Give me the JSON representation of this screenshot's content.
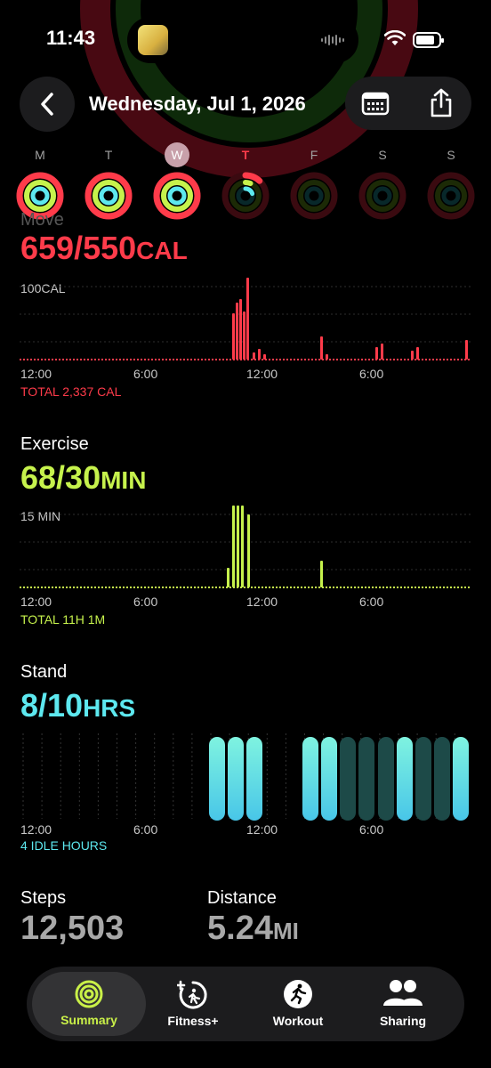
{
  "status": {
    "time": "11:43"
  },
  "header": {
    "date": "Wednesday, Jul 1, 2026"
  },
  "week": [
    {
      "letter": "M",
      "state": "closed"
    },
    {
      "letter": "T",
      "state": "closed"
    },
    {
      "letter": "W",
      "state": "selected"
    },
    {
      "letter": "T",
      "state": "today"
    },
    {
      "letter": "F",
      "state": "empty"
    },
    {
      "letter": "S",
      "state": "empty"
    },
    {
      "letter": "S",
      "state": "empty"
    }
  ],
  "move": {
    "label": "Move",
    "value": "659/550",
    "unit": "CAL",
    "scale_label": "100CAL",
    "x_labels": [
      "12:00",
      "6:00",
      "12:00",
      "6:00"
    ],
    "footer": "TOTAL 2,337 CAL",
    "color": "#ff3b4a"
  },
  "exercise": {
    "label": "Exercise",
    "value": "68/30",
    "unit": "MIN",
    "scale_label": "15 MIN",
    "x_labels": [
      "12:00",
      "6:00",
      "12:00",
      "6:00"
    ],
    "footer": "TOTAL 11H 1M",
    "color": "#c6f24c"
  },
  "stand": {
    "label": "Stand",
    "value": "8/10",
    "unit": "HRS",
    "x_labels": [
      "12:00",
      "6:00",
      "12:00",
      "6:00"
    ],
    "footer": "4 IDLE HOURS",
    "color": "#5de8ef"
  },
  "stats": {
    "steps_label": "Steps",
    "steps_value": "12,503",
    "distance_label": "Distance",
    "distance_value": "5.24",
    "distance_unit": "MI"
  },
  "tabs": [
    {
      "label": "Summary",
      "icon": "summary-rings-icon",
      "active": true
    },
    {
      "label": "Fitness+",
      "icon": "fitness-plus-icon",
      "active": false
    },
    {
      "label": "Workout",
      "icon": "workout-runner-icon",
      "active": false
    },
    {
      "label": "Sharing",
      "icon": "sharing-people-icon",
      "active": false
    }
  ],
  "colors": {
    "move": "#ff3b4a",
    "exercise": "#c6f24c",
    "stand": "#5de8ef",
    "accent": "#c9f048"
  }
}
